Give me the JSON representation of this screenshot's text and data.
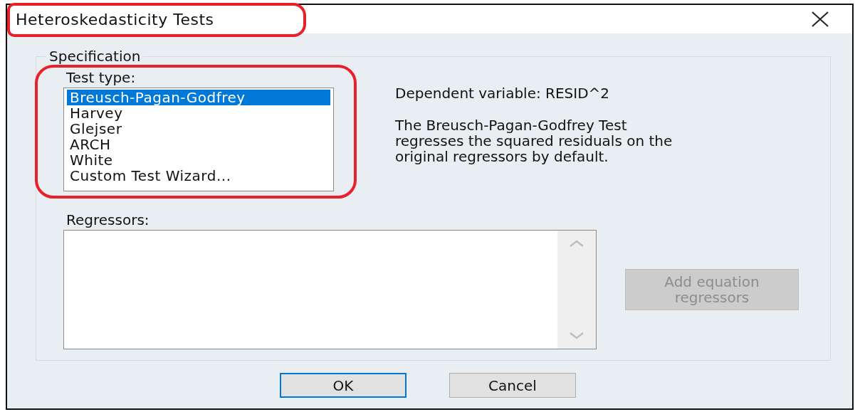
{
  "window": {
    "title": "Heteroskedasticity Tests"
  },
  "specification": {
    "legend": "Specification",
    "test_type": {
      "label": "Test type:",
      "items": [
        {
          "label": "Breusch-Pagan-Godfrey",
          "selected": true
        },
        {
          "label": "Harvey",
          "selected": false
        },
        {
          "label": "Glejser",
          "selected": false
        },
        {
          "label": "ARCH",
          "selected": false
        },
        {
          "label": "White",
          "selected": false
        },
        {
          "label": "Custom Test Wizard...",
          "selected": false
        }
      ]
    },
    "dependent_variable": "Dependent variable: RESID^2",
    "description": "The Breusch-Pagan-Godfrey Test\nregresses the squared residuals on the\noriginal regressors by default.",
    "regressors": {
      "label": "Regressors:"
    },
    "add_button": {
      "label": "Add equation regressors",
      "disabled": true
    }
  },
  "buttons": [
    {
      "label": "OK",
      "focused": true
    },
    {
      "label": "Cancel",
      "focused": false
    }
  ]
}
